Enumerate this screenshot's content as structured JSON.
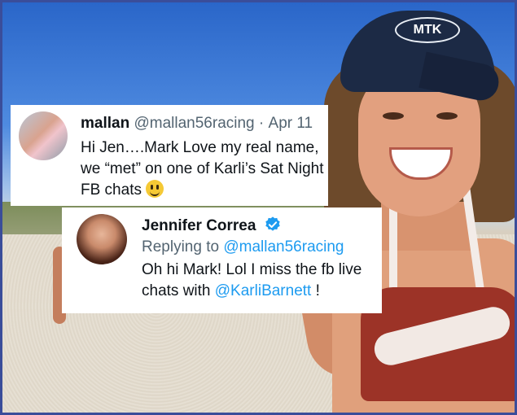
{
  "colors": {
    "link": "#1d9bf0",
    "handle": "#536471",
    "text": "#0f1419",
    "frame": "#3a4d9a"
  },
  "photo": {
    "cap_logo": "MTK"
  },
  "tweet1": {
    "author": "mallan",
    "handle": "@mallan56racing",
    "separator": "·",
    "date": "Apr 11",
    "text": "Hi Jen….Mark Love my real name, we “met” on one of Karli’s Sat Night FB chats",
    "emoji": "smiling-face-emoji"
  },
  "tweet2": {
    "author": "Jennifer Correa",
    "verified_icon": "verified-badge-icon",
    "replying_prefix": "Replying to",
    "replying_to": "@mallan56racing",
    "text_before": "Oh hi Mark! Lol I miss the fb live chats with",
    "mention": "@KarliBarnett",
    "text_after": "!"
  }
}
